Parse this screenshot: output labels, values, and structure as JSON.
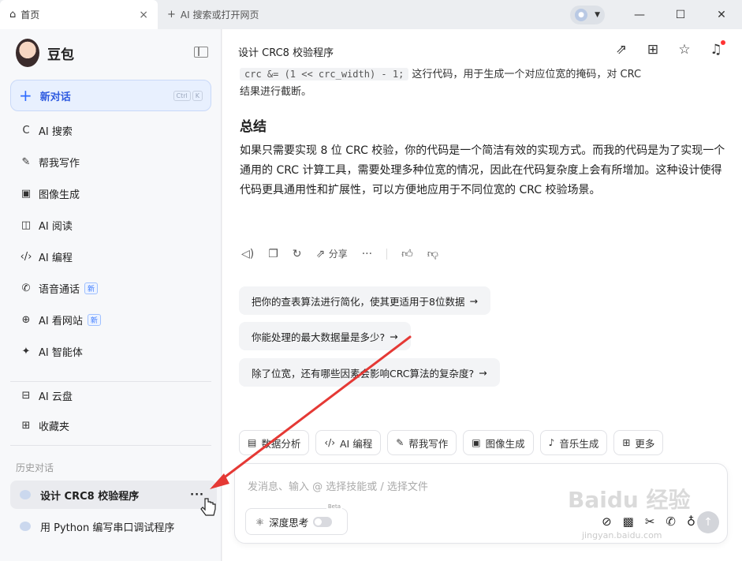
{
  "titlebar": {
    "tabs": [
      {
        "icon": "home-icon",
        "label": "首页"
      },
      {
        "icon": "plus-icon",
        "label": "AI 搜索或打开网页"
      }
    ],
    "close_tab": "×",
    "window": {
      "minimize": "—",
      "maximize": "☐",
      "close": "✕"
    }
  },
  "sidebar": {
    "brand": "豆包",
    "new_chat": {
      "label": "新对话",
      "shortcut": [
        "Ctrl",
        "K"
      ]
    },
    "items": [
      {
        "label": "AI 搜索"
      },
      {
        "label": "帮我写作"
      },
      {
        "label": "图像生成"
      },
      {
        "label": "AI 阅读"
      },
      {
        "label": "AI 编程"
      },
      {
        "label": "语音通话",
        "badge": "新"
      },
      {
        "label": "AI 看网站",
        "badge": "新"
      },
      {
        "label": "AI 智能体"
      },
      {
        "label": "AI 云盘"
      },
      {
        "label": "收藏夹"
      }
    ],
    "history_label": "历史对话",
    "history": [
      {
        "label": "设计 CRC8 校验程序",
        "more": "···"
      },
      {
        "label": "用 Python 编写串口调试程序"
      }
    ]
  },
  "main": {
    "title": "设计 CRC8 校验程序",
    "prev_code": "crc &= (1 << crc_width) - 1;",
    "prev_text_a": " 这行代码，用于生成一个对应位宽的掩码，对 CRC",
    "prev_text_b": "结果进行截断。",
    "heading": "总结",
    "paragraph": "如果只需要实现 8 位 CRC 校验，你的代码是一个简洁有效的实现方式。而我的代码是为了实现一个通用的 CRC 计算工具，需要处理多种位宽的情况，因此在代码复杂度上会有所增加。这种设计使得代码更具通用性和扩展性，可以方便地应用于不同位宽的 CRC 校验场景。",
    "share": "分享",
    "suggestions": [
      "把你的查表算法进行简化，使其更适用于8位数据",
      "你能处理的最大数据量是多少?",
      "除了位宽，还有哪些因素会影响CRC算法的复杂度?"
    ],
    "skills": [
      {
        "icon": "chart-icon",
        "label": "数据分析"
      },
      {
        "icon": "code-icon",
        "label": "AI 编程"
      },
      {
        "icon": "pen-icon",
        "label": "帮我写作"
      },
      {
        "icon": "image-icon",
        "label": "图像生成"
      },
      {
        "icon": "music-icon",
        "label": "音乐生成"
      },
      {
        "icon": "grid-icon",
        "label": "更多"
      }
    ],
    "composer": {
      "placeholder": "发消息、输入 @ 选择技能或 / 选择文件",
      "deep_think": "深度思考",
      "beta": "Beta"
    }
  },
  "watermark": {
    "main": "Baidu 经验",
    "sub": "jingyan.baidu.com"
  },
  "colors": {
    "accent": "#2f6bff",
    "annotation_arrow": "#e53935"
  }
}
